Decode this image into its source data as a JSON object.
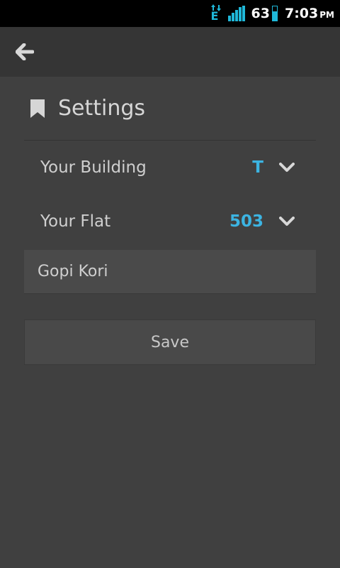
{
  "status_bar": {
    "network_type": "E",
    "battery_percent": "63",
    "time": "7:03",
    "time_suffix": "PM",
    "accent_color": "#1fb8d9"
  },
  "action_bar": {
    "back_icon": "arrow-left-icon"
  },
  "settings": {
    "title": "Settings",
    "icon": "bookmark-icon",
    "building_label": "Your Building",
    "building_value": "T",
    "flat_label": "Your Flat",
    "flat_value": "503",
    "name_value": "Gopi Kori",
    "save_label": "Save",
    "value_color": "#3cb4e2"
  }
}
